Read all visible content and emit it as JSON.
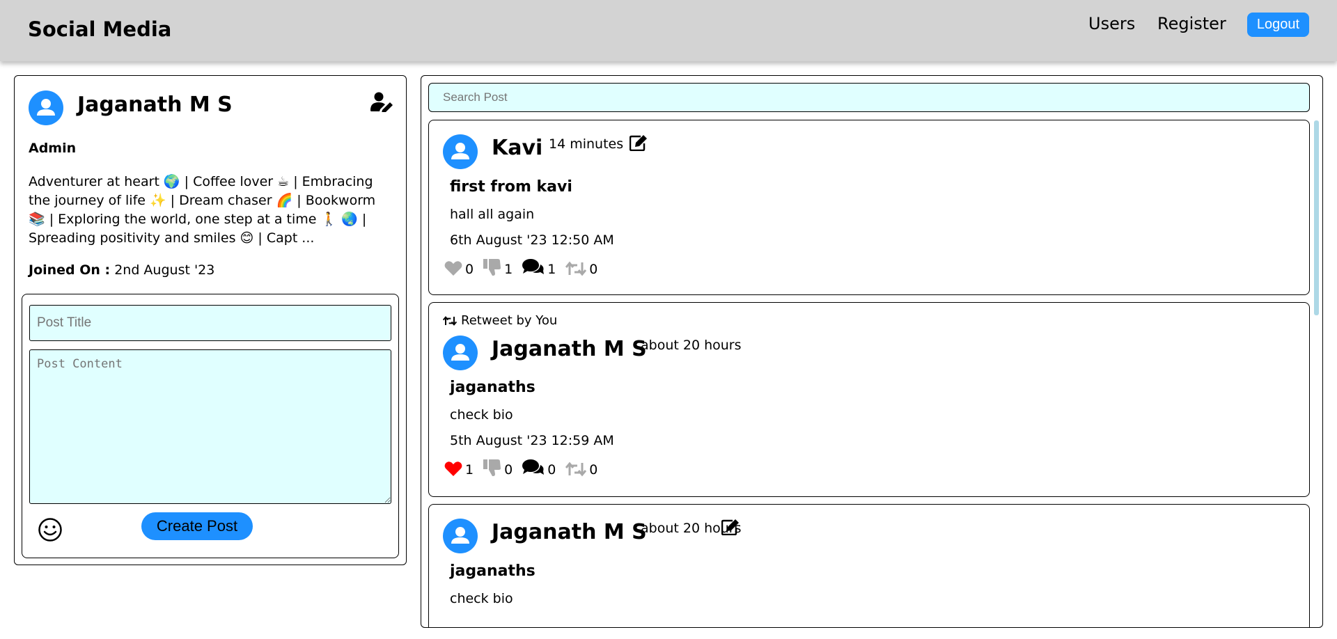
{
  "header": {
    "brand": "Social Media",
    "nav": {
      "users": "Users",
      "register": "Register",
      "logout": "Logout"
    },
    "accent_color": "#1e90ff"
  },
  "profile": {
    "name": "Jaganath M S",
    "role": "Admin",
    "bio": "Adventurer at heart 🌍 | Coffee lover ☕ | Embracing the journey of life ✨ | Dream chaser 🌈 | Bookworm 📚 | Exploring the world, one step at a time 🚶 🌏 | Spreading positivity and smiles 😊 | Capt ...",
    "joined_label": "Joined On :",
    "joined_date": "2nd August '23",
    "icons": {
      "avatar": "user-avatar-icon",
      "edit": "user-edit-icon"
    }
  },
  "composer": {
    "title_placeholder": "Post Title",
    "content_placeholder": "Post Content",
    "create_label": "Create Post",
    "emoji_icon": "smiley-icon"
  },
  "search": {
    "placeholder": "Search Post"
  },
  "posts": [
    {
      "author": "Kavi",
      "time": "14 minutes",
      "editable": true,
      "title": "first from kavi",
      "body": "hall all again",
      "date": "6th August '23 12:50 AM",
      "likes": "0",
      "liked": false,
      "dislikes": "1",
      "comments": "1",
      "retweets": "0"
    },
    {
      "retweet_label": "Retweet by You",
      "author": "Jaganath M S",
      "time": "about 20 hours",
      "editable": false,
      "title": "jaganaths",
      "body": "check bio",
      "date": "5th August '23 12:59 AM",
      "likes": "1",
      "liked": true,
      "dislikes": "0",
      "comments": "0",
      "retweets": "0"
    },
    {
      "author": "Jaganath M S",
      "time": "about 20 hours",
      "editable": true,
      "title": "jaganaths",
      "body": "check bio"
    }
  ],
  "colors": {
    "nav_bg": "#d3d3d3",
    "input_bg": "#e0ffff",
    "like_active": "#ff0000",
    "icon_muted": "#a9a9a9"
  }
}
